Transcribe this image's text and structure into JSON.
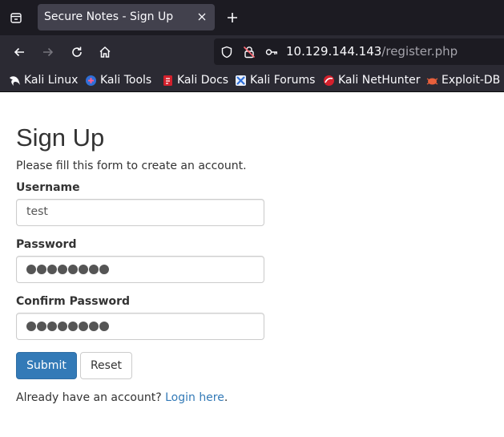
{
  "browser": {
    "tab_title": "Secure Notes - Sign Up",
    "url_host": "10.129.144.143",
    "url_path": "/register.php",
    "bookmarks": [
      "Kali Linux",
      "Kali Tools",
      "Kali Docs",
      "Kali Forums",
      "Kali NetHunter",
      "Exploit-DB"
    ]
  },
  "page": {
    "title": "Sign Up",
    "intro": "Please fill this form to create an account.",
    "username_label": "Username",
    "username_value": "test",
    "password_label": "Password",
    "password_length": 8,
    "confirm_label": "Confirm Password",
    "confirm_length": 8,
    "submit_label": "Submit",
    "reset_label": "Reset",
    "login_prompt": "Already have an account?",
    "login_link": "Login here",
    "login_suffix": "."
  },
  "colors": {
    "primary": "#337ab7",
    "text": "#333333",
    "chrome_dark": "#1c1b22",
    "chrome": "#2b2a33"
  }
}
